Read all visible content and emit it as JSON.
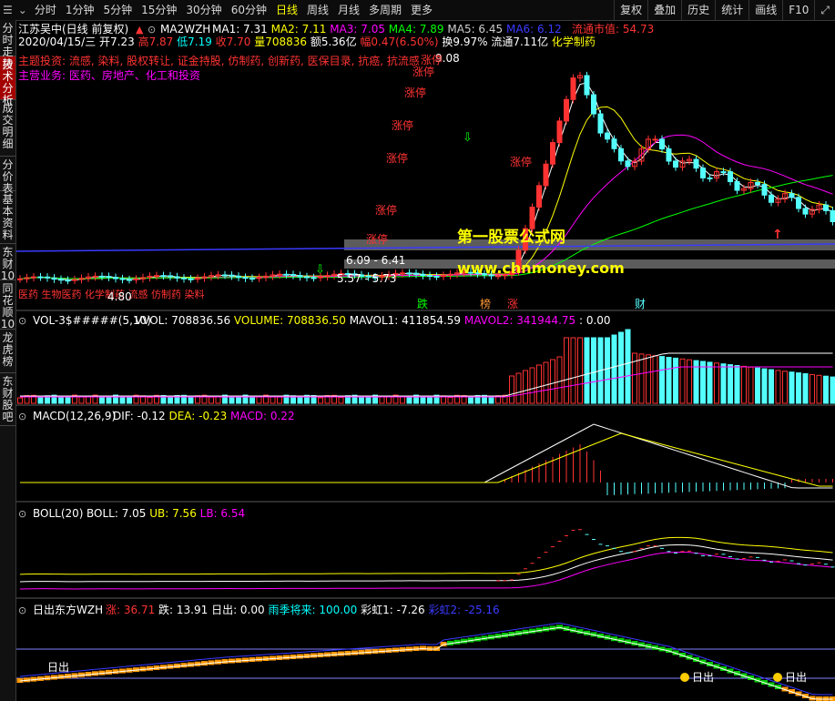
{
  "toolbar": {
    "left": [
      "分时",
      "1分钟",
      "5分钟",
      "15分钟",
      "30分钟",
      "60分钟",
      "日线",
      "周线",
      "月线",
      "多周期",
      "更多"
    ],
    "active": "日线",
    "right": [
      "复权",
      "叠加",
      "历史",
      "统计",
      "画线",
      "F10"
    ]
  },
  "sidebar": [
    {
      "label": "分时走势",
      "active": false
    },
    {
      "label": "技术分析",
      "active": true
    },
    {
      "label": "成交明细",
      "active": false
    },
    {
      "label": "分价表",
      "active": false
    },
    {
      "label": "基本资料",
      "active": false
    },
    {
      "label": "东财10",
      "active": false
    },
    {
      "label": "同花顺10",
      "active": false
    },
    {
      "label": "龙虎榜",
      "active": false
    },
    {
      "label": "东财股吧",
      "active": false
    }
  ],
  "main": {
    "title": "江苏吴中(日线 前复权)",
    "ma_name": "MA2WZH",
    "ma": [
      {
        "label": "MA1: 7.31",
        "color": "#ffffff"
      },
      {
        "label": "MA2: 7.11",
        "color": "#ffff00"
      },
      {
        "label": "MA3: 7.05",
        "color": "#ff00ff"
      },
      {
        "label": "MA4: 7.89",
        "color": "#00ff00"
      },
      {
        "label": "MA5: 6.45",
        "color": "#cfcfcf"
      },
      {
        "label": "MA6: 6.12",
        "color": "#3a3aff"
      }
    ],
    "market_cap": "流通市值: 54.73",
    "info": [
      {
        "t": "2020/04/15/三",
        "c": "#ffffff"
      },
      {
        "t": "开7.23",
        "c": "#ffffff"
      },
      {
        "t": "高7.87",
        "c": "#ff3333"
      },
      {
        "t": "低7.19",
        "c": "#00ffff"
      },
      {
        "t": "收7.70",
        "c": "#ff3333"
      },
      {
        "t": "量708836",
        "c": "#ffff00"
      },
      {
        "t": "额5.36亿",
        "c": "#ffffff"
      },
      {
        "t": "幅0.47(6.50%)",
        "c": "#ff3333"
      },
      {
        "t": "换9.97%",
        "c": "#ffffff"
      },
      {
        "t": "流通7.11亿",
        "c": "#ffffff"
      },
      {
        "t": "化学制药",
        "c": "#ffff00"
      }
    ],
    "theme": "主题投资: 流感, 染料, 股权转让, 证金持股, 仿制药, 创新药, 医保目录, 抗癌, 抗流感",
    "business": "主营业务: 医药、房地产、化工和投资",
    "concept_line": "医药 生物医药 化学制药 流感 仿制药 染料",
    "price_labels": [
      "6.09 - 6.41",
      "5.57 - 5.73",
      "4.80",
      "9.08"
    ],
    "event_labels": [
      "涨停",
      "涨停",
      "涨停",
      "涨停",
      "涨停",
      "涨停",
      "涨停",
      "涨停"
    ],
    "bottom_tags": [
      "跌",
      "榜",
      "涨",
      "财"
    ]
  },
  "watermark": {
    "line1": "第一股票公式网",
    "line2": "www.chnmoney.com"
  },
  "vol_panel": {
    "name": "VOL-3$#####(5,10)",
    "items": [
      {
        "t": "VVOL: 708836.56",
        "c": "#ffffff"
      },
      {
        "t": "VOLUME: 708836.50",
        "c": "#ffff00"
      },
      {
        "t": "MAVOL1: 411854.59",
        "c": "#ffffff"
      },
      {
        "t": "MAVOL2: 341944.75",
        "c": "#ff00ff"
      },
      {
        "t": ": 0.00",
        "c": "#ffffff"
      }
    ]
  },
  "macd_panel": {
    "name": "MACD(12,26,9)",
    "items": [
      {
        "t": "DIF: -0.12",
        "c": "#ffffff"
      },
      {
        "t": "DEA: -0.23",
        "c": "#ffff00"
      },
      {
        "t": "MACD: 0.22",
        "c": "#ff00ff"
      }
    ]
  },
  "boll_panel": {
    "name": "BOLL(20)",
    "items": [
      {
        "t": "BOLL: 7.05",
        "c": "#ffffff"
      },
      {
        "t": "UB: 7.56",
        "c": "#ffff00"
      },
      {
        "t": "LB: 6.54",
        "c": "#ff00ff"
      }
    ]
  },
  "sun_panel": {
    "name": "日出东方WZH",
    "items": [
      {
        "t": "涨: 36.71",
        "c": "#ff3333"
      },
      {
        "t": "跌: 13.91",
        "c": "#ffffff"
      },
      {
        "t": "日出: 0.00",
        "c": "#ffffff"
      },
      {
        "t": "雨季将来: 100.00",
        "c": "#00ffff"
      },
      {
        "t": "彩虹1: -7.26",
        "c": "#ffffff"
      },
      {
        "t": "彩虹2: -25.16",
        "c": "#3a3aff"
      }
    ],
    "marker": "日出"
  },
  "colors": {
    "up": "#ff3232",
    "down": "#54ffff",
    "ma_white": "#ffffff",
    "ma_yellow": "#ffff00",
    "ma_pink": "#ff00ff",
    "ma_green": "#00ff00",
    "ma_blue": "#3a3aff"
  }
}
